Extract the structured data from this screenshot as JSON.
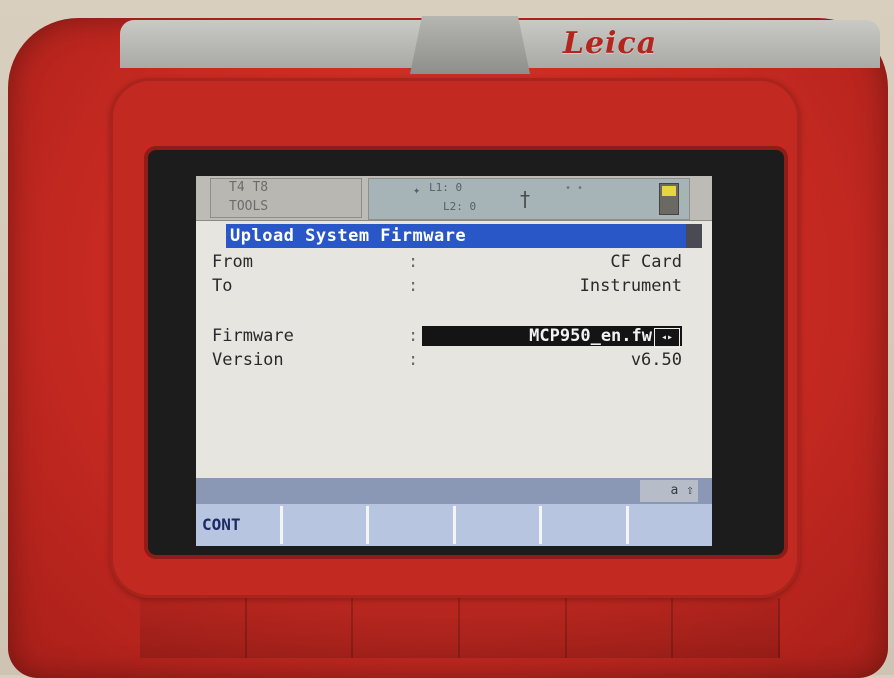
{
  "device": {
    "brand": "Leica"
  },
  "status": {
    "line1": "T4 T8",
    "line2": "TOOLS",
    "signal_line1": "L1: 0",
    "signal_line2": "L2: 0"
  },
  "screen": {
    "title": "Upload System Firmware",
    "rows": [
      {
        "label": "From",
        "sep": ":",
        "value": "CF Card"
      },
      {
        "label": "To",
        "sep": ":",
        "value": "Instrument"
      },
      {
        "label": "Firmware",
        "sep": ":",
        "value": "MCP950_en.fw"
      },
      {
        "label": "Version",
        "sep": ":",
        "value": "v6.50"
      }
    ],
    "indicator": "a ⇧",
    "softkeys": [
      "CONT",
      "",
      "",
      "",
      "",
      ""
    ]
  },
  "icons": {
    "selector": "left-right-arrows-icon",
    "prism": "prism-icon",
    "battery": "battery-icon",
    "antenna": "antenna-icon"
  }
}
